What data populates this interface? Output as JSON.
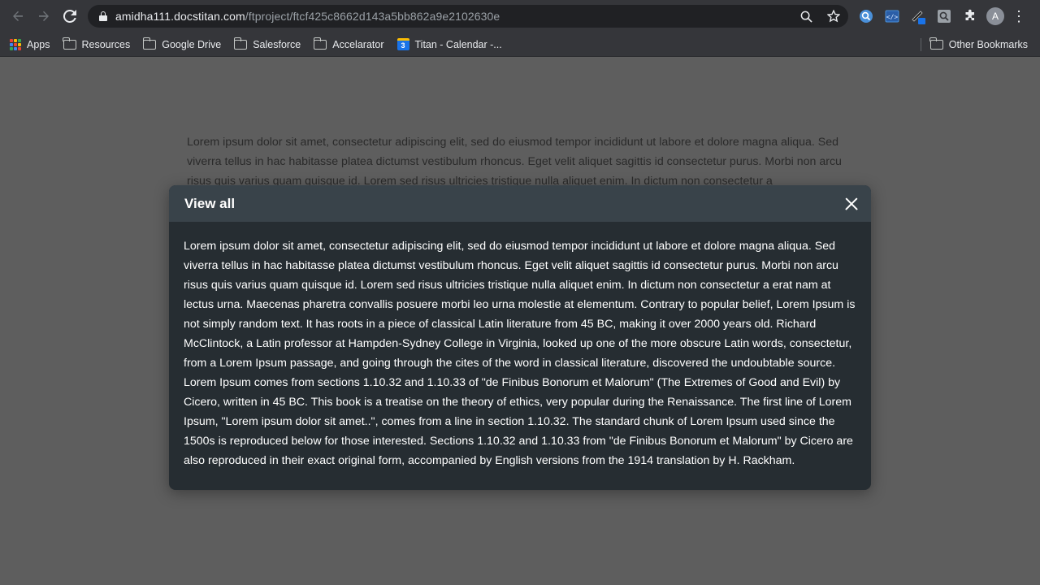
{
  "browser": {
    "url_host": "amidha111.docstitan.com",
    "url_path": "/ftproject/ftcf425c8662d143a5bb862a9e2102630e",
    "profile_initial": "A",
    "icons": [
      "back-icon",
      "forward-icon",
      "reload-icon",
      "lock-icon",
      "zoom-icon",
      "star-icon",
      "extensions-icon",
      "menu-icon"
    ]
  },
  "bookmarks": {
    "items": [
      {
        "label": "Apps",
        "icon": "apps-grid-icon"
      },
      {
        "label": "Resources",
        "icon": "folder-icon"
      },
      {
        "label": "Google Drive",
        "icon": "folder-icon"
      },
      {
        "label": "Salesforce",
        "icon": "folder-icon"
      },
      {
        "label": "Accelarator",
        "icon": "folder-icon"
      },
      {
        "label": "Titan - Calendar -...",
        "icon": "calendar-icon"
      }
    ],
    "other": "Other Bookmarks"
  },
  "page": {
    "background_text": "Lorem ipsum dolor sit amet, consectetur adipiscing elit, sed do eiusmod tempor incididunt ut labore et dolore magna aliqua. Sed viverra tellus in hac habitasse platea dictumst vestibulum rhoncus. Eget velit aliquet sagittis id consectetur purus. Morbi non arcu risus quis varius quam quisque id. Lorem sed risus ultricies tristique nulla aliquet enim. In dictum non consectetur a"
  },
  "modal": {
    "title": "View all",
    "body": "Lorem ipsum dolor sit amet, consectetur adipiscing elit, sed do eiusmod tempor incididunt ut labore et dolore magna aliqua. Sed viverra tellus in hac habitasse platea dictumst vestibulum rhoncus. Eget velit aliquet sagittis id consectetur purus. Morbi non arcu risus quis varius quam quisque id. Lorem sed risus ultricies tristique nulla aliquet enim. In dictum non consectetur a erat nam at lectus urna. Maecenas pharetra convallis posuere morbi leo urna molestie at elementum. Contrary to popular belief, Lorem Ipsum is not simply random text. It has roots in a piece of classical Latin literature from 45 BC, making it over 2000 years old. Richard McClintock, a Latin professor at Hampden-Sydney College in Virginia, looked up one of the more obscure Latin words, consectetur, from a Lorem Ipsum passage, and going through the cites of the word in classical literature, discovered the undoubtable source. Lorem Ipsum comes from sections 1.10.32 and 1.10.33 of \"de Finibus Bonorum et Malorum\" (The Extremes of Good and Evil) by Cicero, written in 45 BC. This book is a treatise on the theory of ethics, very popular during the Renaissance. The first line of Lorem Ipsum, \"Lorem ipsum dolor sit amet..\", comes from a line in section 1.10.32. The standard chunk of Lorem Ipsum used since the 1500s is reproduced below for those interested. Sections 1.10.32 and 1.10.33 from \"de Finibus Bonorum et Malorum\" by Cicero are also reproduced in their exact original form, accompanied by English versions from the 1914 translation by H. Rackham.",
    "close_icon": "close-icon"
  },
  "colors": {
    "overlay": "#5e5e5e",
    "modal_header": "#39434a",
    "modal_body": "#262d32"
  }
}
